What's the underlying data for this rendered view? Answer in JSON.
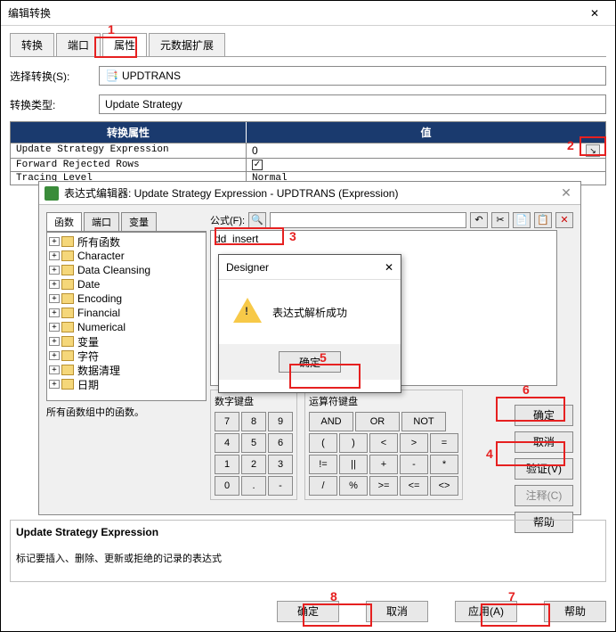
{
  "window": {
    "title": "编辑转换"
  },
  "tabs": [
    "转换",
    "端口",
    "属性",
    "元数据扩展"
  ],
  "activeTab": 2,
  "form": {
    "selectLabel": "选择转换(S):",
    "selectValue": "UPDTRANS",
    "typeLabel": "转换类型:",
    "typeValue": "Update Strategy"
  },
  "propTable": {
    "headers": [
      "转换属性",
      "值"
    ],
    "rows": [
      {
        "name": "Update Strategy Expression",
        "value": "0",
        "hasDrop": true
      },
      {
        "name": "Forward Rejected Rows",
        "value": "",
        "checkbox": true
      },
      {
        "name": "Tracing Level",
        "value": "Normal"
      }
    ]
  },
  "expr": {
    "title": "表达式编辑器: Update Strategy Expression - UPDTRANS (Expression)",
    "innerTabs": [
      "函数",
      "端口",
      "变量"
    ],
    "formulaLabel": "公式(F):",
    "formulaValue": "dd_insert",
    "treeItems": [
      "所有函数",
      "Character",
      "Data Cleansing",
      "Date",
      "Encoding",
      "Financial",
      "Numerical",
      "变量",
      "字符",
      "数据清理",
      "日期"
    ],
    "treeDesc": "所有函数组中的函数。",
    "numpadTitle": "数字键盘",
    "numKeys": [
      "7",
      "8",
      "9",
      "4",
      "5",
      "6",
      "1",
      "2",
      "3",
      "0",
      ".",
      "-"
    ],
    "oppadTitle": "运算符键盘",
    "opRow1": [
      "AND",
      "OR",
      "NOT"
    ],
    "opRow2": [
      "(",
      ")",
      "<",
      ">",
      "=",
      "!=",
      "||",
      "+",
      "-",
      "*",
      "/",
      "%",
      ">=",
      "<=",
      "<>"
    ],
    "buttons": {
      "ok": "确定",
      "cancel": "取消",
      "validate": "验证(V)",
      "comment": "注释(C)",
      "help": "帮助"
    }
  },
  "msg": {
    "title": "Designer",
    "text": "表达式解析成功",
    "ok": "确定"
  },
  "descPanel": {
    "title": "Update Strategy Expression",
    "text": "标记要插入、删除、更新或拒绝的记录的表达式"
  },
  "mainButtons": {
    "ok": "确定",
    "cancel": "取消",
    "apply": "应用(A)",
    "help": "帮助"
  },
  "annotations": [
    "1",
    "2",
    "3",
    "4",
    "5",
    "6",
    "7",
    "8"
  ],
  "icons": {
    "trans": "📑"
  }
}
